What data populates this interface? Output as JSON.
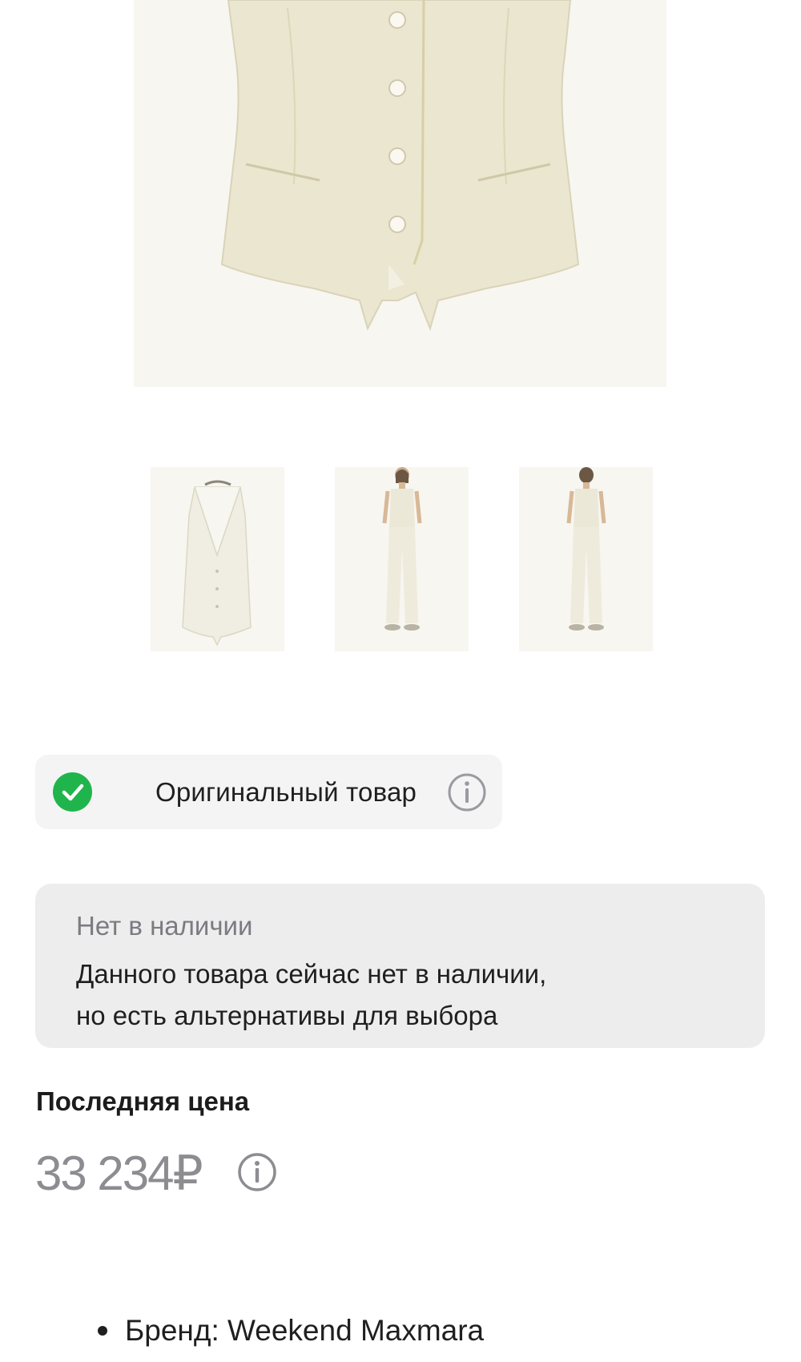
{
  "product": {
    "main_image": "vest-front-closeup",
    "thumbnails": [
      {
        "name": "vest-front"
      },
      {
        "name": "model-front"
      },
      {
        "name": "model-back"
      }
    ]
  },
  "badge": {
    "label": "Оригинальный товар",
    "check_icon": "check-circle-icon",
    "info_icon": "info-icon",
    "check_color": "#1fb54c"
  },
  "stock": {
    "status": "Нет в наличии",
    "text_line1": "Данного товара сейчас нет в наличии,",
    "text_line2": "но есть альтернативы для выбора"
  },
  "price": {
    "label": "Последняя цена",
    "value": "33 234₽",
    "info_icon": "info-icon"
  },
  "details": {
    "brand": "Бренд: Weekend Maxmara"
  }
}
